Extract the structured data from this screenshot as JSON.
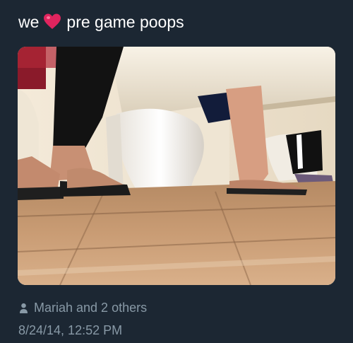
{
  "tweet": {
    "text_before": "we",
    "emoji": "red-heart",
    "text_after": "pre game poops",
    "photo_description": "",
    "likes_text": "Mariah and 2 others",
    "timestamp": "8/24/14, 12:52 PM"
  },
  "colors": {
    "background": "#1c2733",
    "text": "#ffffff",
    "muted": "#8899a6",
    "heart": "#e0245e"
  },
  "icons": {
    "heart": "heart-icon",
    "person": "person-icon"
  }
}
